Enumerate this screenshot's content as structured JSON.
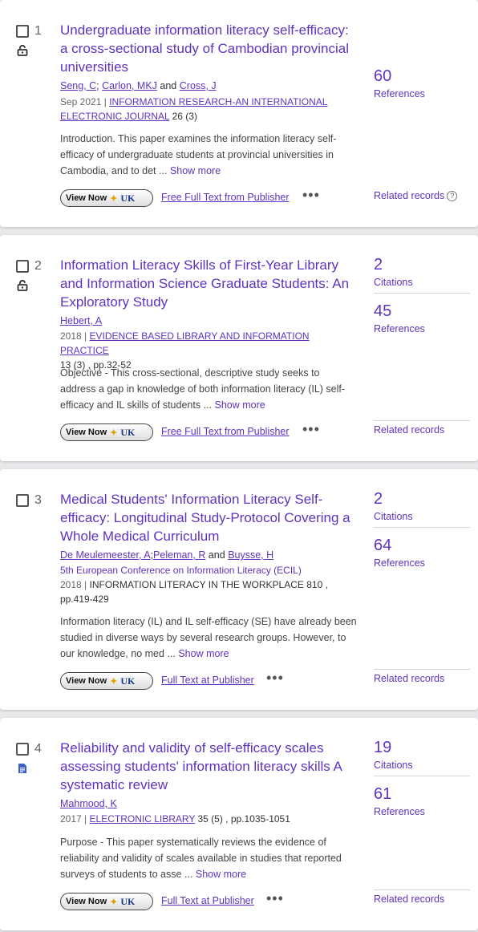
{
  "records": [
    {
      "number": "1",
      "access_icon": "open-access-lock-icon",
      "title": "Undergraduate information literacy self-efficacy: a cross-sectional study of Cambodian provincial universities",
      "authors": [
        "Seng, C",
        "Carlon, MKJ",
        "Cross, J"
      ],
      "author_sep1": ";",
      "author_and": "and",
      "date": "Sep 2021",
      "source": "INFORMATION RESEARCH-AN INTERNATIONAL ELECTRONIC JOURNAL",
      "volume_issue": "26 (3)",
      "abstract": "Introduction. This paper examines the information literacy self-efficacy of undergraduate students at provincial universities in Cambodia, and to det",
      "show_more": "Show more",
      "view_now": "View Now",
      "full_text": "Free Full Text from Publisher",
      "citations_count": "",
      "references_count": "60",
      "references_label": "References",
      "related_label": "Related records"
    },
    {
      "number": "2",
      "access_icon": "open-access-lock-icon",
      "title": "Information Literacy Skills of First-Year Library and Information Science Graduate Students: An Exploratory Study",
      "authors": [
        "Hebert, A"
      ],
      "date": "2018",
      "source": "EVIDENCE BASED LIBRARY AND INFORMATION PRACTICE",
      "volume_issue": "13 (3) , pp.32-52",
      "abstract": "Objective - This cross-sectional, descriptive study seeks to address a gap in knowledge of both information literacy (IL) self-efficacy and IL skills of students",
      "show_more": "Show more",
      "view_now": "View Now",
      "full_text": "Free Full Text from Publisher",
      "citations_count": "2",
      "citations_label": "Citations",
      "references_count": "45",
      "references_label": "References",
      "related_label": "Related records"
    },
    {
      "number": "3",
      "title": "Medical Students' Information Literacy Self-efficacy: Longitudinal Study-Protocol Covering a Whole Medical Curriculum",
      "authors": [
        "De Meulemeester, A",
        "Peleman, R",
        "Buysse, H"
      ],
      "author_and": "and",
      "conference": "5th European Conference on Information Literacy (ECIL)",
      "date": "2018",
      "source": "INFORMATION LITERACY IN THE WORKPLACE",
      "volume_issue": "810 ,",
      "pages": "pp.419-429",
      "abstract": "Information literacy (IL) and IL self-efficacy (SE) have already been studied in diverse ways by several research groups. However, to our knowledge, no med",
      "show_more": "Show more",
      "view_now": "View Now",
      "full_text": "Full Text at Publisher",
      "citations_count": "2",
      "citations_label": "Citations",
      "references_count": "64",
      "references_label": "References",
      "related_label": "Related records"
    },
    {
      "number": "4",
      "access_icon": "document-icon",
      "title": "Reliability and validity of self-efficacy scales assessing students' information literacy skills A systematic review",
      "authors": [
        "Mahmood, K"
      ],
      "date": "2017",
      "source": "ELECTRONIC LIBRARY",
      "volume_issue": "35 (5) , pp.1035-1051",
      "abstract": "Purpose - This paper systematically reviews the evidence of reliability and validity of scales available in studies that reported surveys of students to asse",
      "show_more": "Show more",
      "view_now": "View Now",
      "full_text": "Full Text at Publisher",
      "citations_count": "19",
      "citations_label": "Citations",
      "references_count": "61",
      "references_label": "References",
      "related_label": "Related records"
    }
  ],
  "common": {
    "separator": "|",
    "ellipsis": "...",
    "more_actions": "•••",
    "uk_logo": "UK",
    "help_glyph": "?"
  },
  "colors": {
    "link": "#5e33bf",
    "background": "#e9e9ec",
    "card": "#ffffff"
  }
}
